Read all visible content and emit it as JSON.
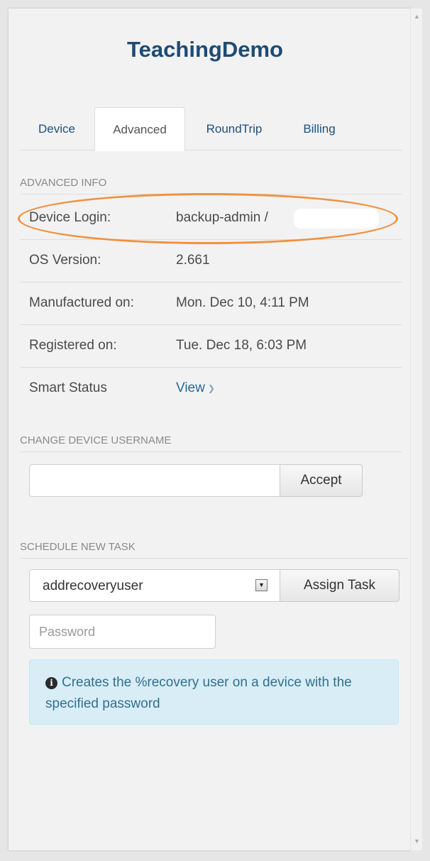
{
  "app_title": "TeachingDemo",
  "tabs": [
    {
      "label": "Device",
      "active": false
    },
    {
      "label": "Advanced",
      "active": true
    },
    {
      "label": "RoundTrip",
      "active": false
    },
    {
      "label": "Billing",
      "active": false
    }
  ],
  "advanced_info": {
    "heading": "ADVANCED INFO",
    "rows": [
      {
        "label": "Device Login:",
        "value": "backup-admin /"
      },
      {
        "label": "OS Version:",
        "value": "2.661"
      },
      {
        "label": "Manufactured on:",
        "value": "Mon. Dec 10, 4:11 PM"
      },
      {
        "label": "Registered on:",
        "value": "Tue. Dec 18, 6:03 PM"
      },
      {
        "label": "Smart Status",
        "value": "View",
        "icon": "chevron-down-icon"
      }
    ]
  },
  "change_username": {
    "heading": "CHANGE DEVICE USERNAME",
    "input_value": "",
    "accept_label": "Accept"
  },
  "schedule_task": {
    "heading": "SCHEDULE NEW TASK",
    "selected_task": "addrecoveryuser",
    "assign_label": "Assign Task",
    "password_placeholder": "Password",
    "info_text": "Creates the %recovery user on a device with the specified password"
  },
  "colors": {
    "title": "#1e4b76",
    "link": "#1f6aa0",
    "highlight_oval": "#f0913f",
    "alert_bg": "#d9edf7",
    "alert_text": "#31708f"
  }
}
